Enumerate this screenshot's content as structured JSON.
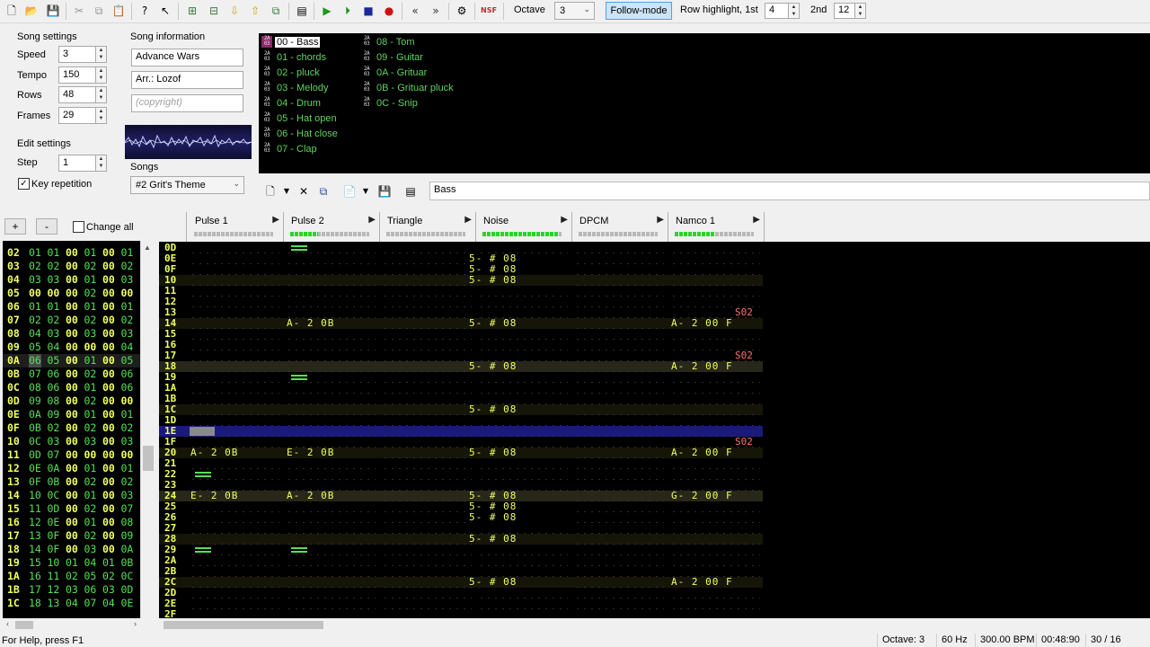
{
  "toolbar": {
    "octave_label": "Octave",
    "octave_value": "3",
    "follow_mode": "Follow-mode",
    "row_highlight_label": "Row highlight, 1st",
    "row_highlight_1st": "4",
    "second_label": "2nd",
    "row_highlight_2nd": "12",
    "nsf_label": "NSF"
  },
  "song_settings": {
    "title": "Song settings",
    "speed_label": "Speed",
    "speed": "3",
    "tempo_label": "Tempo",
    "tempo": "150",
    "rows_label": "Rows",
    "rows": "48",
    "frames_label": "Frames",
    "frames": "29"
  },
  "edit_settings": {
    "title": "Edit settings",
    "step_label": "Step",
    "step": "1",
    "key_repetition": "Key repetition",
    "key_repetition_checked": true
  },
  "song_info": {
    "title": "Song information",
    "name": "Advance Wars",
    "artist": "Arr.: Lozof",
    "copyright_placeholder": "(copyright)"
  },
  "songs": {
    "label": "Songs",
    "selected": "#2 Grit's Theme"
  },
  "instruments": {
    "icon_text": "2A03",
    "items": [
      "00 - Bass",
      "01 - chords",
      "02 - pluck",
      "03 - Melody",
      "04 - Drum",
      "05 - Hat open",
      "06 - Hat close",
      "07 - Clap",
      "08 - Tom",
      "09 - Guitar",
      "0A - Grituar",
      "0B - Grituar pluck",
      "0C - Snip"
    ],
    "selected_index": 0,
    "name_field": "Bass"
  },
  "frame_controls": {
    "add": "+",
    "remove": "-",
    "change_all": "Change all"
  },
  "frames": [
    [
      "02",
      "01",
      "01",
      "00",
      "01",
      "00",
      "01"
    ],
    [
      "03",
      "02",
      "02",
      "00",
      "02",
      "00",
      "02"
    ],
    [
      "04",
      "03",
      "03",
      "00",
      "01",
      "00",
      "03"
    ],
    [
      "05",
      "00",
      "00",
      "00",
      "02",
      "00",
      "00"
    ],
    [
      "06",
      "01",
      "01",
      "00",
      "01",
      "00",
      "01"
    ],
    [
      "07",
      "02",
      "02",
      "00",
      "02",
      "00",
      "02"
    ],
    [
      "08",
      "04",
      "03",
      "00",
      "03",
      "00",
      "03"
    ],
    [
      "09",
      "05",
      "04",
      "00",
      "00",
      "00",
      "04"
    ],
    [
      "0A",
      "06",
      "05",
      "00",
      "01",
      "00",
      "05"
    ],
    [
      "0B",
      "07",
      "06",
      "00",
      "02",
      "00",
      "06"
    ],
    [
      "0C",
      "08",
      "06",
      "00",
      "01",
      "00",
      "06"
    ],
    [
      "0D",
      "09",
      "08",
      "00",
      "02",
      "00",
      "00"
    ],
    [
      "0E",
      "0A",
      "09",
      "00",
      "01",
      "00",
      "01"
    ],
    [
      "0F",
      "0B",
      "02",
      "00",
      "02",
      "00",
      "02"
    ],
    [
      "10",
      "0C",
      "03",
      "00",
      "03",
      "00",
      "03"
    ],
    [
      "11",
      "0D",
      "07",
      "00",
      "00",
      "00",
      "00"
    ],
    [
      "12",
      "0E",
      "0A",
      "00",
      "01",
      "00",
      "01"
    ],
    [
      "13",
      "0F",
      "0B",
      "00",
      "02",
      "00",
      "02"
    ],
    [
      "14",
      "10",
      "0C",
      "00",
      "01",
      "00",
      "03"
    ],
    [
      "15",
      "11",
      "0D",
      "00",
      "02",
      "00",
      "07"
    ],
    [
      "16",
      "12",
      "0E",
      "00",
      "01",
      "00",
      "08"
    ],
    [
      "17",
      "13",
      "0F",
      "00",
      "02",
      "00",
      "09"
    ],
    [
      "18",
      "14",
      "0F",
      "00",
      "03",
      "00",
      "0A"
    ],
    [
      "19",
      "15",
      "10",
      "01",
      "04",
      "01",
      "0B"
    ],
    [
      "1A",
      "16",
      "11",
      "02",
      "05",
      "02",
      "0C"
    ],
    [
      "1B",
      "17",
      "12",
      "03",
      "06",
      "03",
      "0D"
    ],
    [
      "1C",
      "18",
      "13",
      "04",
      "07",
      "04",
      "0E"
    ]
  ],
  "current_frame_index": 8,
  "channels": [
    {
      "name": "Pulse 1",
      "level": 0
    },
    {
      "name": "Pulse 2",
      "level": 0.35
    },
    {
      "name": "Triangle",
      "level": 0
    },
    {
      "name": "Noise",
      "level": 0.95
    },
    {
      "name": "DPCM",
      "level": 0
    },
    {
      "name": "Namco 1",
      "level": 0.5
    }
  ],
  "pattern_rows": [
    {
      "row": "0D",
      "cells": {
        "1": "=="
      }
    },
    {
      "row": "0E",
      "cells": {
        "3": "5- # 08"
      }
    },
    {
      "row": "0F",
      "cells": {
        "3": "5- # 08"
      }
    },
    {
      "row": "10",
      "cells": {
        "3": "5- # 08"
      }
    },
    {
      "row": "11",
      "cells": {}
    },
    {
      "row": "12",
      "cells": {}
    },
    {
      "row": "13",
      "cells": {},
      "effect": "S02"
    },
    {
      "row": "14",
      "cells": {
        "1": "A- 2 0B",
        "3": "5- # 08",
        "5": "A- 2 00 F"
      }
    },
    {
      "row": "15",
      "cells": {}
    },
    {
      "row": "16",
      "cells": {}
    },
    {
      "row": "17",
      "cells": {},
      "effect": "S02"
    },
    {
      "row": "18",
      "cells": {
        "3": "5- # 08",
        "5": "A- 2 00 F"
      }
    },
    {
      "row": "19",
      "cells": {
        "1": "=="
      }
    },
    {
      "row": "1A",
      "cells": {}
    },
    {
      "row": "1B",
      "cells": {}
    },
    {
      "row": "1C",
      "cells": {
        "3": "5- # 08"
      }
    },
    {
      "row": "1D",
      "cells": {}
    },
    {
      "row": "1E",
      "cells": {}
    },
    {
      "row": "1F",
      "cells": {},
      "effect": "S02"
    },
    {
      "row": "20",
      "cells": {
        "0": "A- 2 0B",
        "1": "E- 2 0B",
        "3": "5- # 08",
        "5": "A- 2 00 F"
      }
    },
    {
      "row": "21",
      "cells": {}
    },
    {
      "row": "22",
      "cells": {
        "0": "=="
      }
    },
    {
      "row": "23",
      "cells": {}
    },
    {
      "row": "24",
      "cells": {
        "0": "E- 2 0B",
        "1": "A- 2 0B",
        "3": "5- # 08",
        "5": "G- 2 00 F"
      }
    },
    {
      "row": "25",
      "cells": {
        "3": "5- # 08"
      }
    },
    {
      "row": "26",
      "cells": {
        "3": "5- # 08"
      }
    },
    {
      "row": "27",
      "cells": {}
    },
    {
      "row": "28",
      "cells": {
        "3": "5- # 08"
      }
    },
    {
      "row": "29",
      "cells": {
        "0": "==",
        "1": "=="
      }
    },
    {
      "row": "2A",
      "cells": {}
    },
    {
      "row": "2B",
      "cells": {}
    },
    {
      "row": "2C",
      "cells": {
        "3": "5- # 08",
        "5": "A- 2 00 F"
      }
    },
    {
      "row": "2D",
      "cells": {}
    },
    {
      "row": "2E",
      "cells": {}
    },
    {
      "row": "2F",
      "cells": {}
    }
  ],
  "cursor_row": "1E",
  "status": {
    "help": "For Help, press F1",
    "octave": "Octave: 3",
    "rate": "60 Hz",
    "bpm": "300.00 BPM",
    "time": "00:48:90",
    "position": "30 / 16"
  }
}
